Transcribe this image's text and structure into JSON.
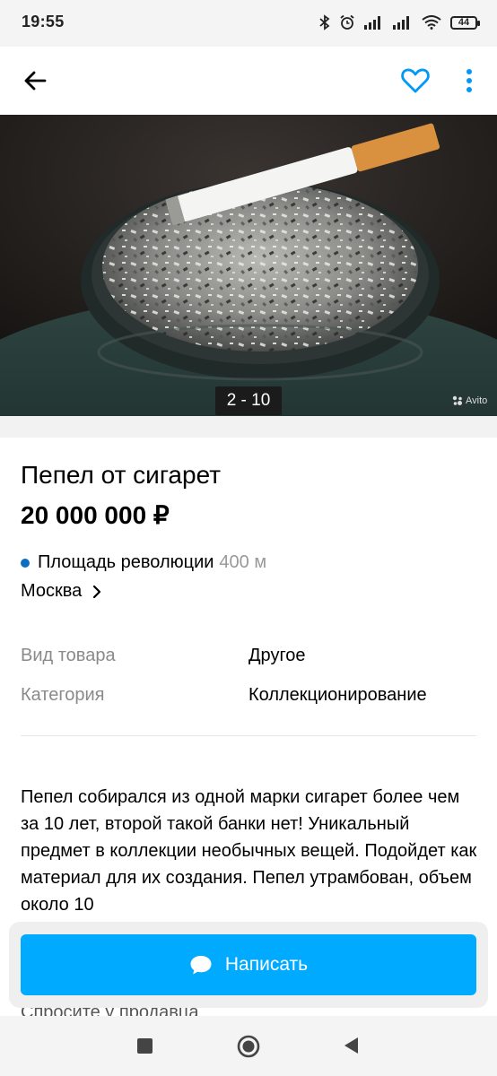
{
  "status_bar": {
    "time": "19:55",
    "battery": "44"
  },
  "listing": {
    "image_counter": "2 - 10",
    "watermark": "Avito",
    "title": "Пепел от сигарет",
    "price": "20 000 000 ₽",
    "metro_station": "Площадь революции",
    "metro_distance": "400 м",
    "city": "Москва",
    "params": [
      {
        "label": "Вид товара",
        "value": "Другое"
      },
      {
        "label": "Категория",
        "value": "Коллекционирование"
      }
    ],
    "description": "Пепел собирался из одной марки сигарет более чем за 10 лет, второй такой банки нет! Уникальный предмет в коллекции необычных вещей. Подойдет как материал для их создания. Пепел утрамбован, объем около 10",
    "ask_seller": "Спросите у продавца"
  },
  "actions": {
    "write_label": "Написать"
  },
  "colors": {
    "accent": "#00aaff",
    "favorite": "#0099f7",
    "metro_line": "#0a6fc2"
  }
}
